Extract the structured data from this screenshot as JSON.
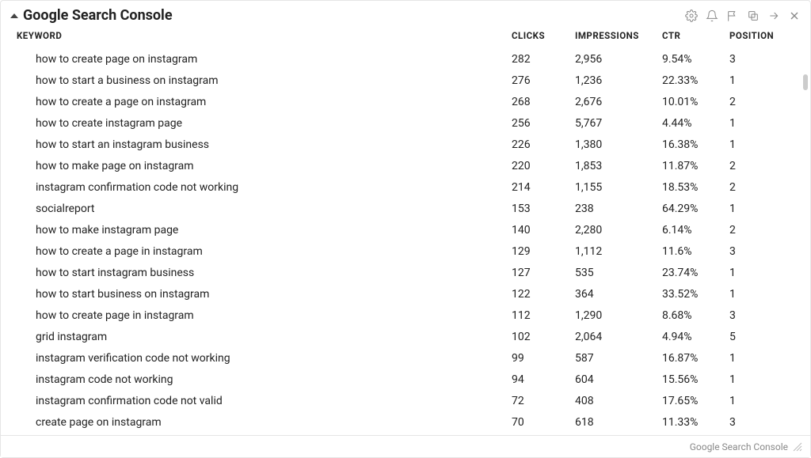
{
  "header": {
    "title": "Google Search Console"
  },
  "columns": {
    "keyword": "KEYWORD",
    "clicks": "CLICKS",
    "impressions": "IMPRESSIONS",
    "ctr": "CTR",
    "position": "POSITION"
  },
  "rows": [
    {
      "keyword": "how to create page on instagram",
      "clicks": "282",
      "impressions": "2,956",
      "ctr": "9.54%",
      "position": "3"
    },
    {
      "keyword": "how to start a business on instagram",
      "clicks": "276",
      "impressions": "1,236",
      "ctr": "22.33%",
      "position": "1"
    },
    {
      "keyword": "how to create a page on instagram",
      "clicks": "268",
      "impressions": "2,676",
      "ctr": "10.01%",
      "position": "2"
    },
    {
      "keyword": "how to create instagram page",
      "clicks": "256",
      "impressions": "5,767",
      "ctr": "4.44%",
      "position": "1"
    },
    {
      "keyword": "how to start an instagram business",
      "clicks": "226",
      "impressions": "1,380",
      "ctr": "16.38%",
      "position": "1"
    },
    {
      "keyword": "how to make page on instagram",
      "clicks": "220",
      "impressions": "1,853",
      "ctr": "11.87%",
      "position": "2"
    },
    {
      "keyword": "instagram confirmation code not working",
      "clicks": "214",
      "impressions": "1,155",
      "ctr": "18.53%",
      "position": "2"
    },
    {
      "keyword": "socialreport",
      "clicks": "153",
      "impressions": "238",
      "ctr": "64.29%",
      "position": "1"
    },
    {
      "keyword": "how to make instagram page",
      "clicks": "140",
      "impressions": "2,280",
      "ctr": "6.14%",
      "position": "2"
    },
    {
      "keyword": "how to create a page in instagram",
      "clicks": "129",
      "impressions": "1,112",
      "ctr": "11.6%",
      "position": "3"
    },
    {
      "keyword": "how to start instagram business",
      "clicks": "127",
      "impressions": "535",
      "ctr": "23.74%",
      "position": "1"
    },
    {
      "keyword": "how to start business on instagram",
      "clicks": "122",
      "impressions": "364",
      "ctr": "33.52%",
      "position": "1"
    },
    {
      "keyword": "how to create page in instagram",
      "clicks": "112",
      "impressions": "1,290",
      "ctr": "8.68%",
      "position": "3"
    },
    {
      "keyword": "grid instagram",
      "clicks": "102",
      "impressions": "2,064",
      "ctr": "4.94%",
      "position": "5"
    },
    {
      "keyword": "instagram verification code not working",
      "clicks": "99",
      "impressions": "587",
      "ctr": "16.87%",
      "position": "1"
    },
    {
      "keyword": "instagram code not working",
      "clicks": "94",
      "impressions": "604",
      "ctr": "15.56%",
      "position": "1"
    },
    {
      "keyword": "instagram confirmation code not valid",
      "clicks": "72",
      "impressions": "408",
      "ctr": "17.65%",
      "position": "1"
    },
    {
      "keyword": "create page on instagram",
      "clicks": "70",
      "impressions": "618",
      "ctr": "11.33%",
      "position": "3"
    }
  ],
  "footer": {
    "source_label": "Google Search Console"
  }
}
